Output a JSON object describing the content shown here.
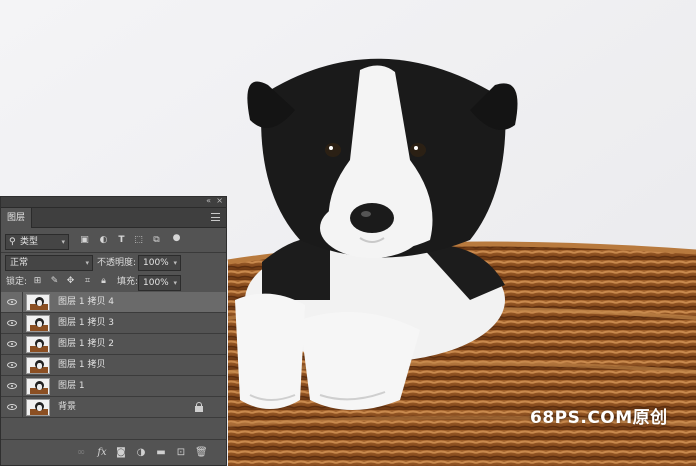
{
  "watermark": "68PS.COM原创",
  "panel": {
    "collapse_icon": "«",
    "close_icon": "×",
    "tab_label": "图层",
    "filter": {
      "type_label": "类型",
      "icons": [
        "image-filter-icon",
        "adjustment-filter-icon",
        "type-filter-icon",
        "shape-filter-icon",
        "smart-object-filter-icon",
        "filter-toggle-icon"
      ]
    },
    "blend_mode": "正常",
    "opacity_label": "不透明度:",
    "opacity_value": "100%",
    "lock_label": "锁定:",
    "fill_label": "填充:",
    "fill_value": "100%",
    "layers": [
      {
        "name": "图层 1 拷贝 4",
        "active": true
      },
      {
        "name": "图层 1 拷贝 3",
        "active": false
      },
      {
        "name": "图层 1 拷贝 2",
        "active": false
      },
      {
        "name": "图层 1 拷贝",
        "active": false
      },
      {
        "name": "图层 1",
        "active": false
      },
      {
        "name": "背景",
        "active": false,
        "locked": true
      }
    ],
    "footer_icons": [
      "link-icon",
      "fx-icon",
      "mask-icon",
      "adjustment-layer-icon",
      "group-folder-icon",
      "new-layer-icon",
      "trash-icon"
    ]
  },
  "colors": {
    "panel_bg": "#535353",
    "active_row": "#6a6a6a",
    "basket": "#8b4f22"
  }
}
